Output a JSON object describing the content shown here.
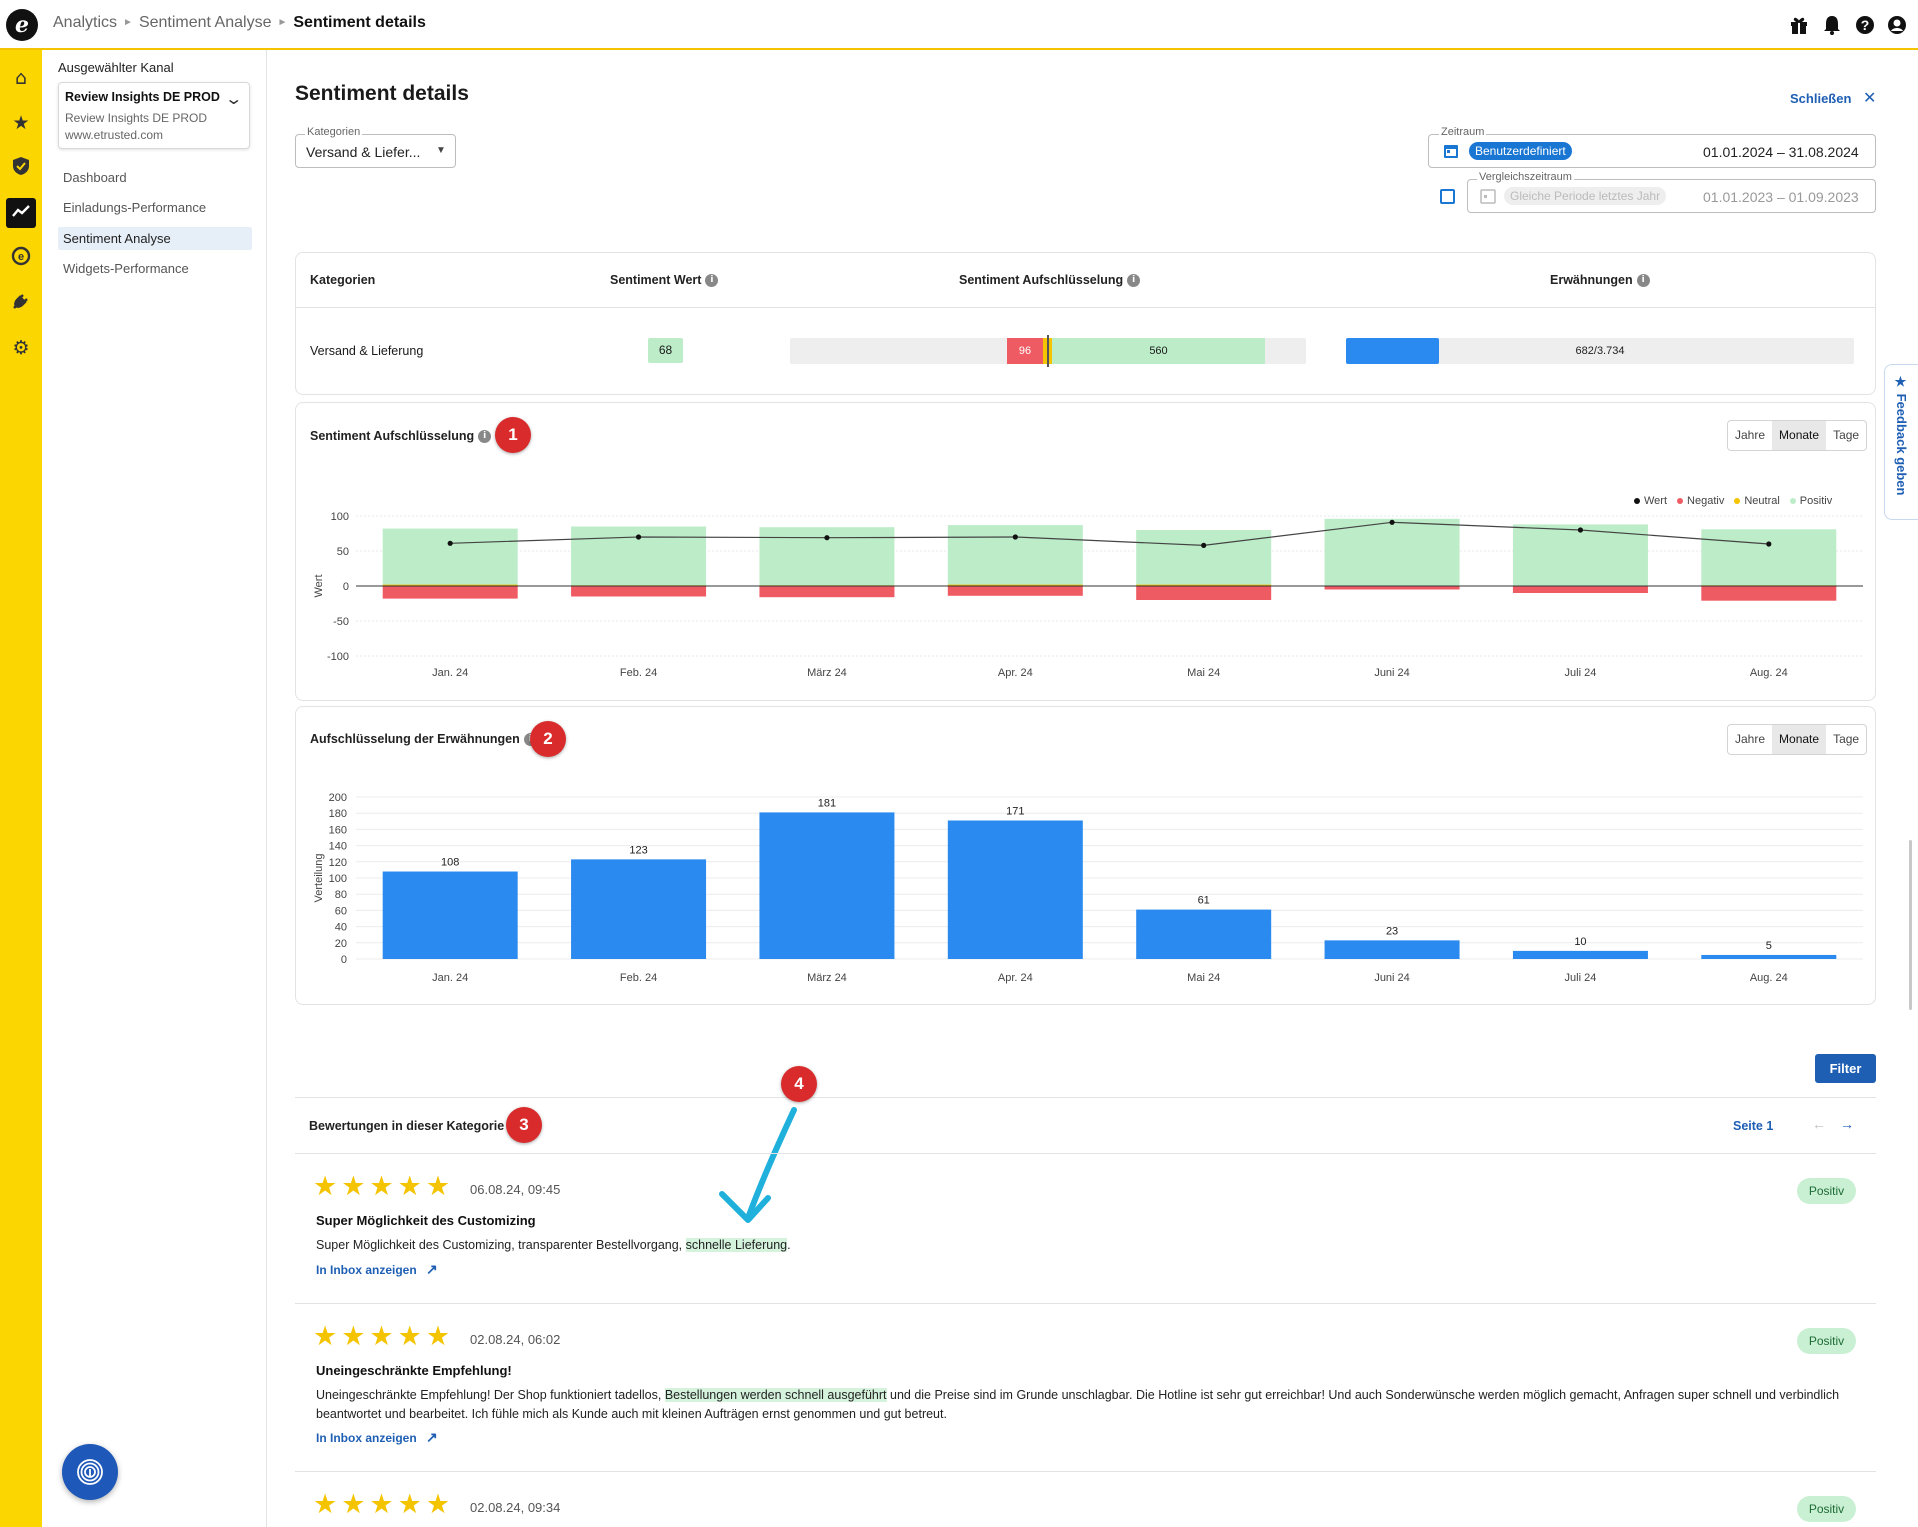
{
  "breadcrumb": {
    "root": "Analytics",
    "section": "Sentiment Analyse",
    "current": "Sentiment details"
  },
  "topbar_icons": [
    "gift-icon",
    "bell-icon",
    "help-icon",
    "account-icon"
  ],
  "rail_icons": [
    "home-icon",
    "star-icon",
    "shield-icon",
    "analytics-icon",
    "etrusted-icon",
    "plug-icon",
    "settings-icon"
  ],
  "sidebar": {
    "channel_label": "Ausgewählter Kanal",
    "channel_name": "Review Insights DE PROD",
    "channel_sub": "Review Insights DE PROD",
    "channel_url": "www.etrusted.com",
    "items": [
      {
        "label": "Dashboard"
      },
      {
        "label": "Einladungs-Performance"
      },
      {
        "label": "Sentiment Analyse"
      },
      {
        "label": "Widgets-Performance"
      }
    ]
  },
  "page": {
    "title": "Sentiment details",
    "close_label": "Schließen"
  },
  "filters": {
    "category_label": "Kategorien",
    "category_value": "Versand & Liefer...",
    "zeitraum_label": "Zeitraum",
    "zeitraum_chip": "Benutzerdefiniert",
    "zeitraum_value": "01.01.2024 – 31.08.2024",
    "vergleich_label": "Vergleichszeitraum",
    "vergleich_chip": "Gleiche Periode letztes Jahr",
    "vergleich_value": "01.01.2023 – 01.09.2023"
  },
  "summary": {
    "headers": {
      "kategorien": "Kategorien",
      "wert": "Sentiment Wert",
      "aufschluesselung": "Sentiment Aufschlüsselung",
      "erwaehnungen": "Erwähnungen"
    },
    "row": {
      "category": "Versand & Lieferung",
      "wert": "68",
      "negativ": "96",
      "positiv": "560",
      "mentions": "682/3.734",
      "mentions_fraction": 0.183
    }
  },
  "colors": {
    "positiv": "#bcedc8",
    "negativ": "#ef5b63",
    "neutral": "#f5c400",
    "bar": "#2b8af0",
    "accent": "#1e5fb4",
    "badge": "#d92b2b"
  },
  "sentiment_card": {
    "title": "Sentiment Aufschlüsselung",
    "badge": "1",
    "toggle": [
      "Jahre",
      "Monate",
      "Tage"
    ],
    "active": "Monate",
    "legend": [
      "Wert",
      "Negativ",
      "Neutral",
      "Positiv"
    ],
    "ylabel": "Wert"
  },
  "mentions_card": {
    "title": "Aufschlüsselung der Erwähnungen",
    "badge": "2",
    "toggle": [
      "Jahre",
      "Monate",
      "Tage"
    ],
    "active": "Monate",
    "ylabel": "Verteilung"
  },
  "chart_data": [
    {
      "type": "bar",
      "title": "Sentiment Aufschlüsselung",
      "categories": [
        "Jan. 24",
        "Feb. 24",
        "März 24",
        "Apr. 24",
        "Mai 24",
        "Juni 24",
        "Juli 24",
        "Aug. 24"
      ],
      "ylim": [
        -100,
        100
      ],
      "yticks": [
        100,
        50,
        0,
        -50,
        -100
      ],
      "ylabel": "Wert",
      "stacked": true,
      "series": [
        {
          "name": "Positiv",
          "values": [
            80,
            84,
            83,
            85,
            78,
            96,
            88,
            80
          ]
        },
        {
          "name": "Neutral",
          "values": [
            2,
            1,
            1,
            2,
            2,
            0,
            0,
            1
          ]
        },
        {
          "name": "Negativ",
          "values": [
            -18,
            -15,
            -16,
            -14,
            -20,
            -5,
            -10,
            -21
          ]
        },
        {
          "name": "Wert",
          "type": "line",
          "values": [
            61,
            70,
            69,
            70,
            58,
            91,
            80,
            60
          ]
        }
      ]
    },
    {
      "type": "bar",
      "title": "Aufschlüsselung der Erwähnungen",
      "categories": [
        "Jan. 24",
        "Feb. 24",
        "März 24",
        "Apr. 24",
        "Mai 24",
        "Juni 24",
        "Juli 24",
        "Aug. 24"
      ],
      "values": [
        108,
        123,
        181,
        171,
        61,
        23,
        10,
        5
      ],
      "ylim": [
        0,
        200
      ],
      "yticks": [
        200,
        180,
        160,
        140,
        120,
        100,
        80,
        60,
        40,
        20,
        0
      ],
      "ylabel": "Verteilung"
    }
  ],
  "reviews_section": {
    "filter_label": "Filter",
    "title": "Bewertungen in dieser Kategorie",
    "badge3": "3",
    "badge4": "4",
    "page": "Seite 1"
  },
  "reviews": [
    {
      "date": "06.08.24, 09:45",
      "title": "Super Möglichkeit des Customizing",
      "body_pre": "Super Möglichkeit des Customizing, transparenter Bestellvorgang, ",
      "body_hl": "schnelle Lieferung",
      "body_post": ".",
      "link": "In Inbox anzeigen",
      "sentiment": "Positiv",
      "rating": 5
    },
    {
      "date": "02.08.24, 06:02",
      "title": "Uneingeschränkte Empfehlung!",
      "body_pre": "Uneingeschränkte Empfehlung! Der Shop funktioniert tadellos, ",
      "body_hl": "Bestellungen werden schnell ausgeführt",
      "body_post": "  und die Preise sind im Grunde unschlagbar. Die Hotline ist sehr gut erreichbar! Und auch Sonderwünsche werden möglich gemacht, Anfragen super schnell und verbindlich beantwortet und bearbeitet. Ich fühle mich als Kunde auch mit kleinen Aufträgen ernst genommen und gut betreut.",
      "link": "In Inbox anzeigen",
      "sentiment": "Positiv",
      "rating": 5
    },
    {
      "date": "02.08.24, 09:34",
      "sentiment": "Positiv",
      "rating": 5
    }
  ],
  "feedback_label": "★ Feedback geben"
}
